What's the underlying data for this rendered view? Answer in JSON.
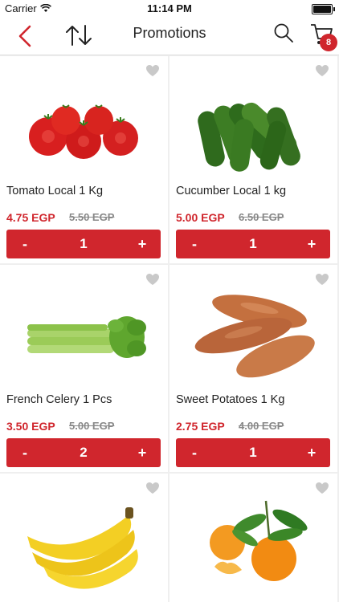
{
  "status_bar": {
    "carrier": "Carrier",
    "time": "11:14 PM"
  },
  "nav": {
    "title": "Promotions",
    "cart_count": "8"
  },
  "colors": {
    "accent": "#d0262d",
    "background": "#efefef"
  },
  "products": [
    {
      "name": "Tomato Local 1 Kg",
      "price": "4.75 EGP",
      "old_price": "5.50 EGP",
      "quantity": "1",
      "minus": "-",
      "plus": "+",
      "image": "tomato"
    },
    {
      "name": "Cucumber Local 1 kg",
      "price": "5.00 EGP",
      "old_price": "6.50 EGP",
      "quantity": "1",
      "minus": "-",
      "plus": "+",
      "image": "cucumber"
    },
    {
      "name": "French Celery 1 Pcs",
      "price": "3.50 EGP",
      "old_price": "5.00 EGP",
      "quantity": "2",
      "minus": "-",
      "plus": "+",
      "image": "celery"
    },
    {
      "name": "Sweet Potatoes 1 Kg",
      "price": "2.75 EGP",
      "old_price": "4.00 EGP",
      "quantity": "1",
      "minus": "-",
      "plus": "+",
      "image": "sweet-potato"
    },
    {
      "name": "",
      "price": "",
      "old_price": "",
      "quantity": "",
      "image": "banana"
    },
    {
      "name": "",
      "price": "",
      "old_price": "",
      "quantity": "",
      "image": "mandarin"
    }
  ]
}
